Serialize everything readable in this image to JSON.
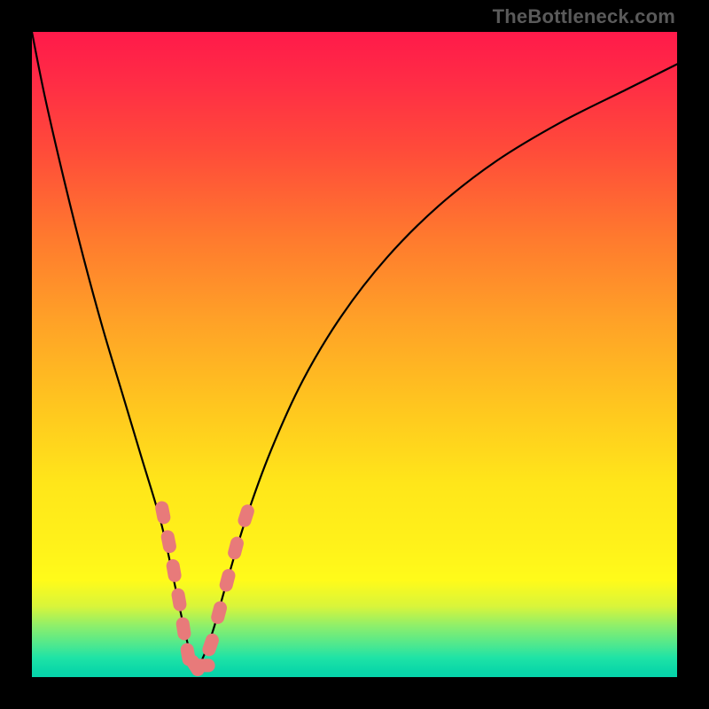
{
  "watermark": "TheBottleneck.com",
  "chart_data": {
    "type": "line",
    "title": "",
    "xlabel": "",
    "ylabel": "",
    "xlim": [
      0,
      100
    ],
    "ylim": [
      0,
      100
    ],
    "series": [
      {
        "name": "bottleneck-curve",
        "x": [
          0,
          2,
          5,
          8,
          11,
          14,
          17,
          20,
          22,
          23.5,
          25,
          26,
          28,
          30,
          33,
          37,
          42,
          48,
          55,
          63,
          72,
          82,
          92,
          100
        ],
        "values": [
          100,
          90,
          77,
          65,
          54,
          44,
          34,
          24,
          15,
          8,
          2,
          2,
          7,
          14,
          24,
          35,
          46,
          56,
          65,
          73,
          80,
          86,
          91,
          95
        ]
      }
    ],
    "markers": {
      "name": "highlighted-segments",
      "color": "#e87a7a",
      "points": [
        {
          "x": 20.3,
          "y": 25.5
        },
        {
          "x": 21.2,
          "y": 21.0
        },
        {
          "x": 22.0,
          "y": 16.5
        },
        {
          "x": 22.8,
          "y": 12.0
        },
        {
          "x": 23.5,
          "y": 7.5
        },
        {
          "x": 24.2,
          "y": 3.5
        },
        {
          "x": 25.3,
          "y": 1.8
        },
        {
          "x": 26.6,
          "y": 1.8
        },
        {
          "x": 27.7,
          "y": 5.0
        },
        {
          "x": 29.0,
          "y": 10.0
        },
        {
          "x": 30.3,
          "y": 15.0
        },
        {
          "x": 31.6,
          "y": 20.0
        },
        {
          "x": 33.2,
          "y": 25.0
        }
      ]
    },
    "grid": false,
    "legend": false
  }
}
